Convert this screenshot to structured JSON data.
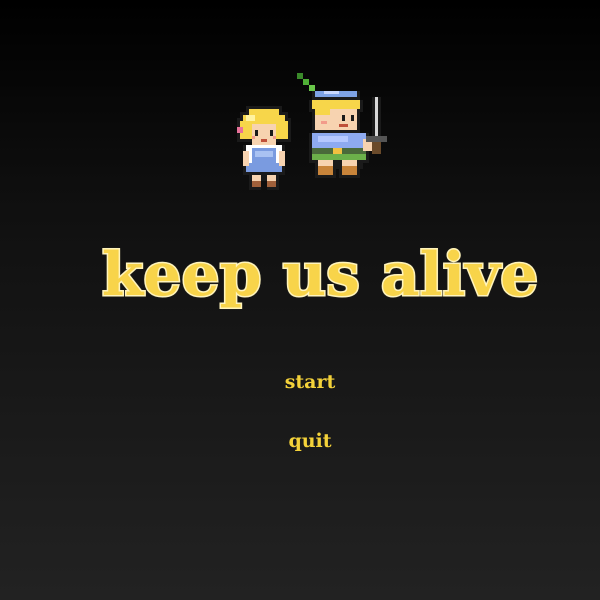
{
  "game": {
    "title": "keep us alive"
  },
  "menu": {
    "start_label": "start",
    "quit_label": "quit"
  },
  "colors": {
    "title_fill": "#f8d44a",
    "title_outline": "#fff3b8",
    "menu_text": "#f4d23a",
    "background_top": "#000000",
    "background_bottom": "#222222"
  },
  "characters": [
    "girl-sprite",
    "boy-with-sword-sprite"
  ]
}
